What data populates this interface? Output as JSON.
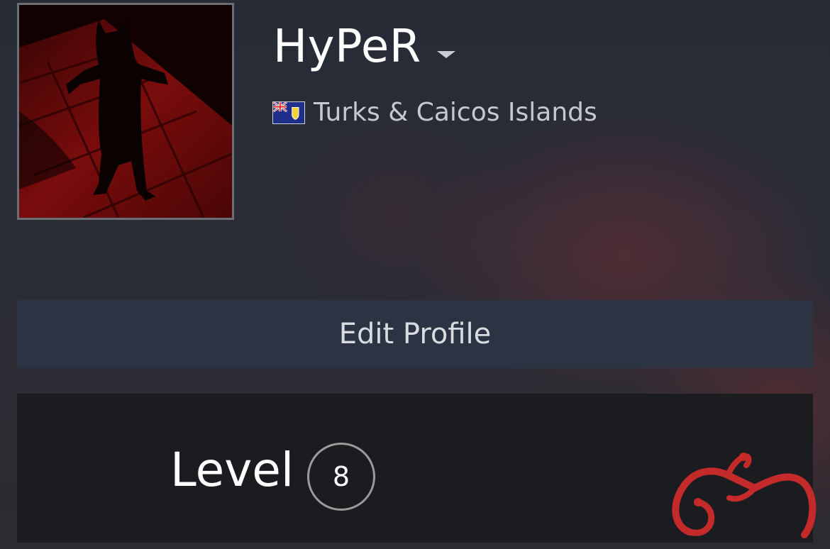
{
  "profile": {
    "username": "HyPeR",
    "country": "Turks & Caicos Islands",
    "avatar_icon": "avatar-image",
    "flag_icon": "turks-caicos-flag-icon"
  },
  "actions": {
    "edit_profile_label": "Edit Profile"
  },
  "level": {
    "label": "Level",
    "value": "8"
  },
  "colors": {
    "accent_red": "#c42a2a",
    "button_bg": "#2c3444",
    "panel_bg": "#1b1c20"
  }
}
